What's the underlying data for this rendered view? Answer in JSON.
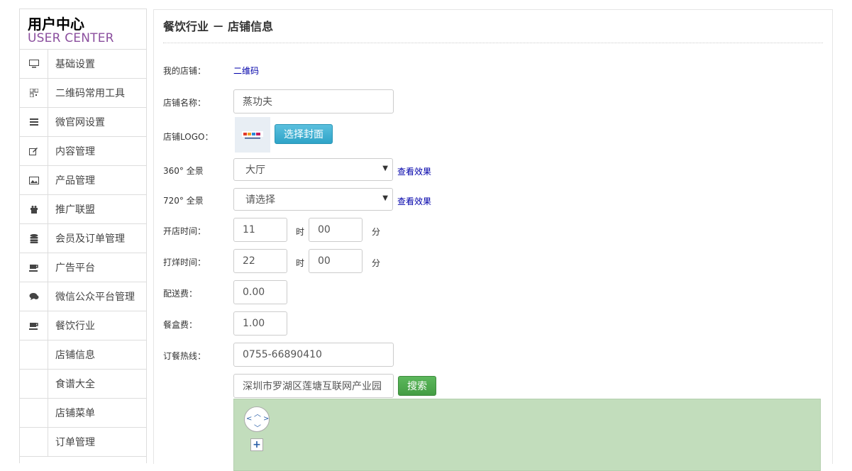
{
  "sidebar": {
    "brand_cn": "用户中心",
    "brand_en": "USER CENTER",
    "items": [
      {
        "label": "基础设置",
        "icon": "monitor-icon"
      },
      {
        "label": "二维码常用工具",
        "icon": "qrcode-icon"
      },
      {
        "label": "微官网设置",
        "icon": "list-icon"
      },
      {
        "label": "内容管理",
        "icon": "edit-icon"
      },
      {
        "label": "产品管理",
        "icon": "image-icon"
      },
      {
        "label": "推广联盟",
        "icon": "gift-icon"
      },
      {
        "label": "会员及订单管理",
        "icon": "database-icon"
      },
      {
        "label": "广告平台",
        "icon": "coffee-icon"
      },
      {
        "label": "微信公众平台管理",
        "icon": "comments-icon"
      },
      {
        "label": "餐饮行业",
        "icon": "coffee-icon"
      }
    ],
    "sub_items": [
      "店铺信息",
      "食谱大全",
      "店铺菜单",
      "订单管理"
    ]
  },
  "main": {
    "title": "餐饮行业 － 店铺信息",
    "my_store_label": "我的店铺：",
    "my_store_link": "二维码",
    "store_name_label": "店铺名称：",
    "store_name_value": "蒸功夫",
    "logo_label": "店铺LOGO：",
    "logo_button": "选择封面",
    "pano360_label": "360° 全景",
    "pano360_value": "大厅",
    "pano720_label": "720° 全景",
    "pano720_value": "请选择",
    "view_effect": "查看效果",
    "open_time_label": "开店时间：",
    "open_hour": "11",
    "open_min": "00",
    "close_time_label": "打烊时间：",
    "close_hour": "22",
    "close_min": "00",
    "hour_unit": "时",
    "min_unit": "分",
    "delivery_fee_label": "配送费：",
    "delivery_fee_value": "0.00",
    "box_fee_label": "餐盒费：",
    "box_fee_value": "1.00",
    "hotline_label": "订餐热线：",
    "hotline_value": "0755-66890410",
    "address_value": "深圳市罗湖区莲塘互联网产业园",
    "search_button": "搜索",
    "zoom_in": "+"
  },
  "colors": {
    "brand_en": "#8b4f9e",
    "link": "#0000aa",
    "info_button": "#31b0d5",
    "success_button": "#5cb85c",
    "map_bg": "#c2ddbc"
  }
}
